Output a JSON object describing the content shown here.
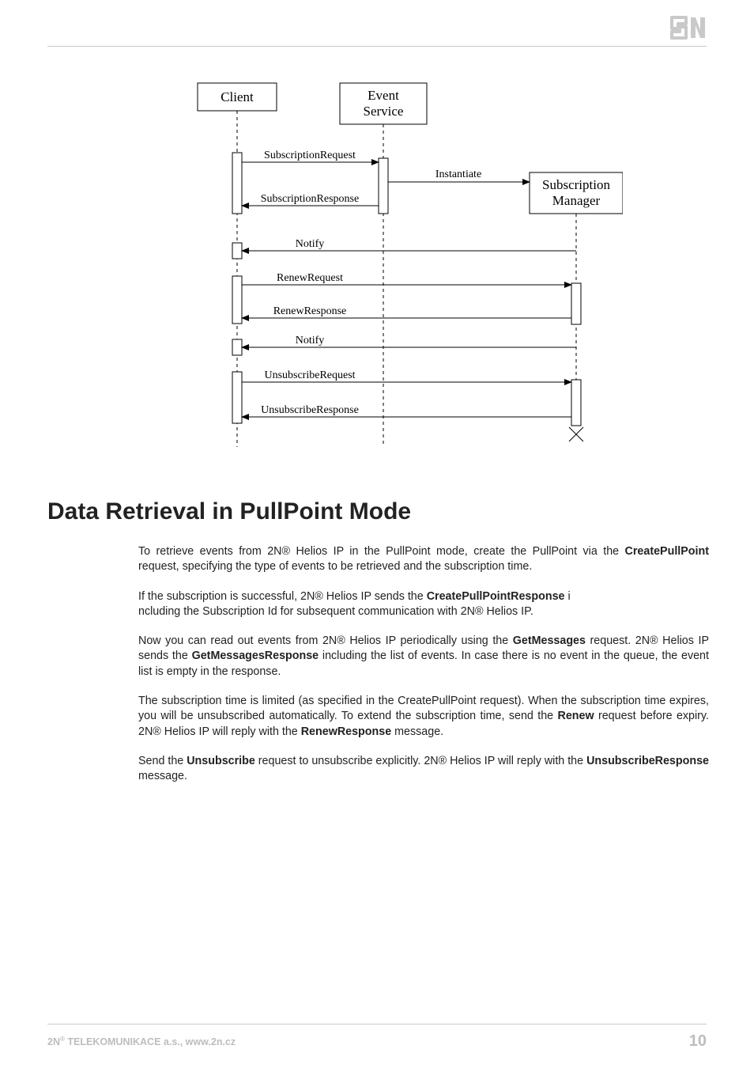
{
  "logo_text": "2N",
  "diagram": {
    "client_label": "Client",
    "event_service_label_line1": "Event",
    "event_service_label_line2": "Service",
    "sub_mgr_label_line1": "Subscription",
    "sub_mgr_label_line2": "Manager",
    "messages": {
      "sub_req": "SubscriptionRequest",
      "sub_resp": "SubscriptionResponse",
      "instantiate": "Instantiate",
      "notify1": "Notify",
      "renew_req": "RenewRequest",
      "renew_resp": "RenewResponse",
      "notify2": "Notify",
      "unsub_req": "UnsubscribeRequest",
      "unsub_resp": "UnsubscribeResponse"
    }
  },
  "heading": "Data Retrieval in PullPoint Mode",
  "paragraphs": {
    "p1a": "To retrieve events from 2N® Helios IP in the PullPoint mode, create the PullPoint via the ",
    "p1b": "CreatePullPoint",
    "p1c": " request, specifying the type of events to be retrieved and the subscription time.",
    "p2a": "If the subscription is successful, 2N® Helios IP sends the ",
    "p2b": "CreatePullPointResponse",
    "p2c": " i",
    "p2d": "ncluding the Subscription Id for subsequent communication with 2N® Helios IP.",
    "p3a": "Now you can read out events from 2N® Helios IP periodically using the ",
    "p3b": "GetMessages",
    "p3c": " request. 2N® Helios IP sends the ",
    "p3d": "GetMessagesResponse",
    "p3e": " including the list of events. In case there is no event in the queue, the event list is empty in the response.",
    "p4a": "The subscription time is limited (as specified in the CreatePullPoint request). When the subscription time expires, you will be unsubscribed automatically. To extend the subscription time, send the ",
    "p4b": "Renew",
    "p4c": " request before expiry. 2N® Helios IP will reply with the ",
    "p4d": "RenewResponse",
    "p4e": " message.",
    "p5a": "Send the ",
    "p5b": "Unsubscribe",
    "p5c": " request to unsubscribe explicitly. 2N® Helios IP will reply with the ",
    "p5d": "UnsubscribeResponse",
    "p5e": " message."
  },
  "footer": {
    "company_prefix": "2N",
    "company_sup": "®",
    "company_rest": " TELEKOMUNIKACE a.s., www.2n.cz",
    "page_number": "10"
  }
}
